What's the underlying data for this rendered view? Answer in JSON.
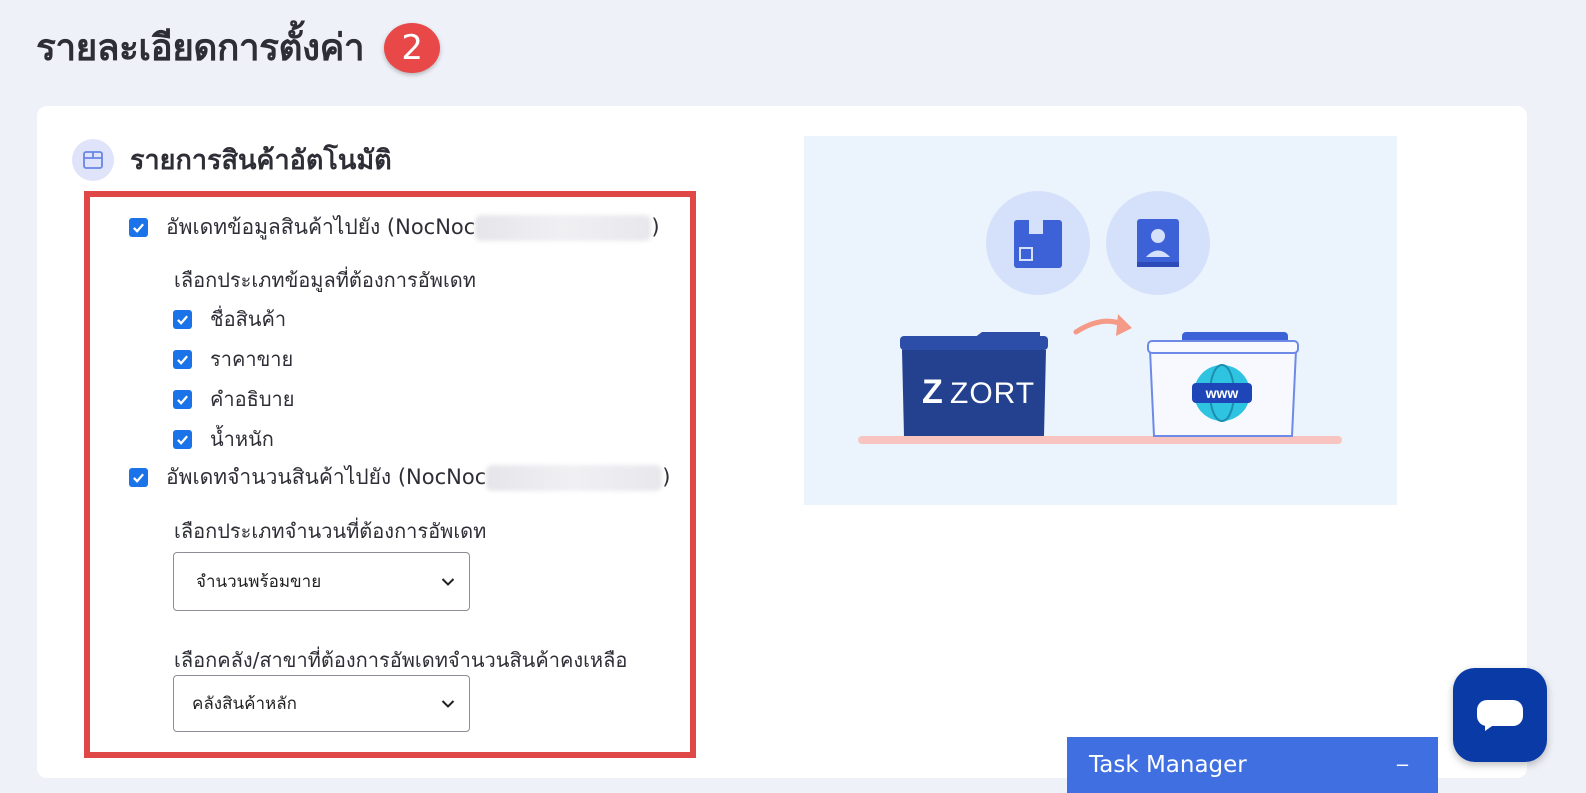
{
  "page": {
    "title": "รายละเอียดการตั้งค่า",
    "step_number": "2"
  },
  "section": {
    "title": "รายการสินค้าอัตโนมัติ",
    "icon": "box-icon"
  },
  "options": {
    "update_product_info": {
      "label": "อัพเดทข้อมูลสินค้าไปยัง (NocNoc",
      "suffix": ")",
      "checked": true
    },
    "product_info_types_label": "เลือกประเภทข้อมูลที่ต้องการอัพเดท",
    "product_info_types": [
      {
        "label": "ชื่อสินค้า",
        "checked": true
      },
      {
        "label": "ราคาขาย",
        "checked": true
      },
      {
        "label": "คำอธิบาย",
        "checked": true
      },
      {
        "label": "น้ำหนัก",
        "checked": true
      }
    ],
    "update_stock": {
      "label": "อัพเดทจำนวนสินค้าไปยัง (NocNoc",
      "suffix": ")",
      "checked": true
    },
    "stock_type_label": "เลือกประเภทจำนวนที่ต้องการอัพเดท",
    "stock_type_value": "จำนวนพร้อมขาย",
    "warehouse_label": "เลือกคลัง/สาขาที่ต้องการอัพเดทจำนวนสินค้าคงเหลือ",
    "warehouse_value": "คลังสินค้าหลัก"
  },
  "illustration": {
    "source_label": "ZORT",
    "target_label": "www"
  },
  "task_manager": {
    "label": "Task Manager",
    "minimize": "−"
  },
  "colors": {
    "accent": "#1a73e8",
    "highlight": "#e04848",
    "badge": "#e84848",
    "chat": "#0a3aa6",
    "task_bar": "#3f6fe0"
  }
}
